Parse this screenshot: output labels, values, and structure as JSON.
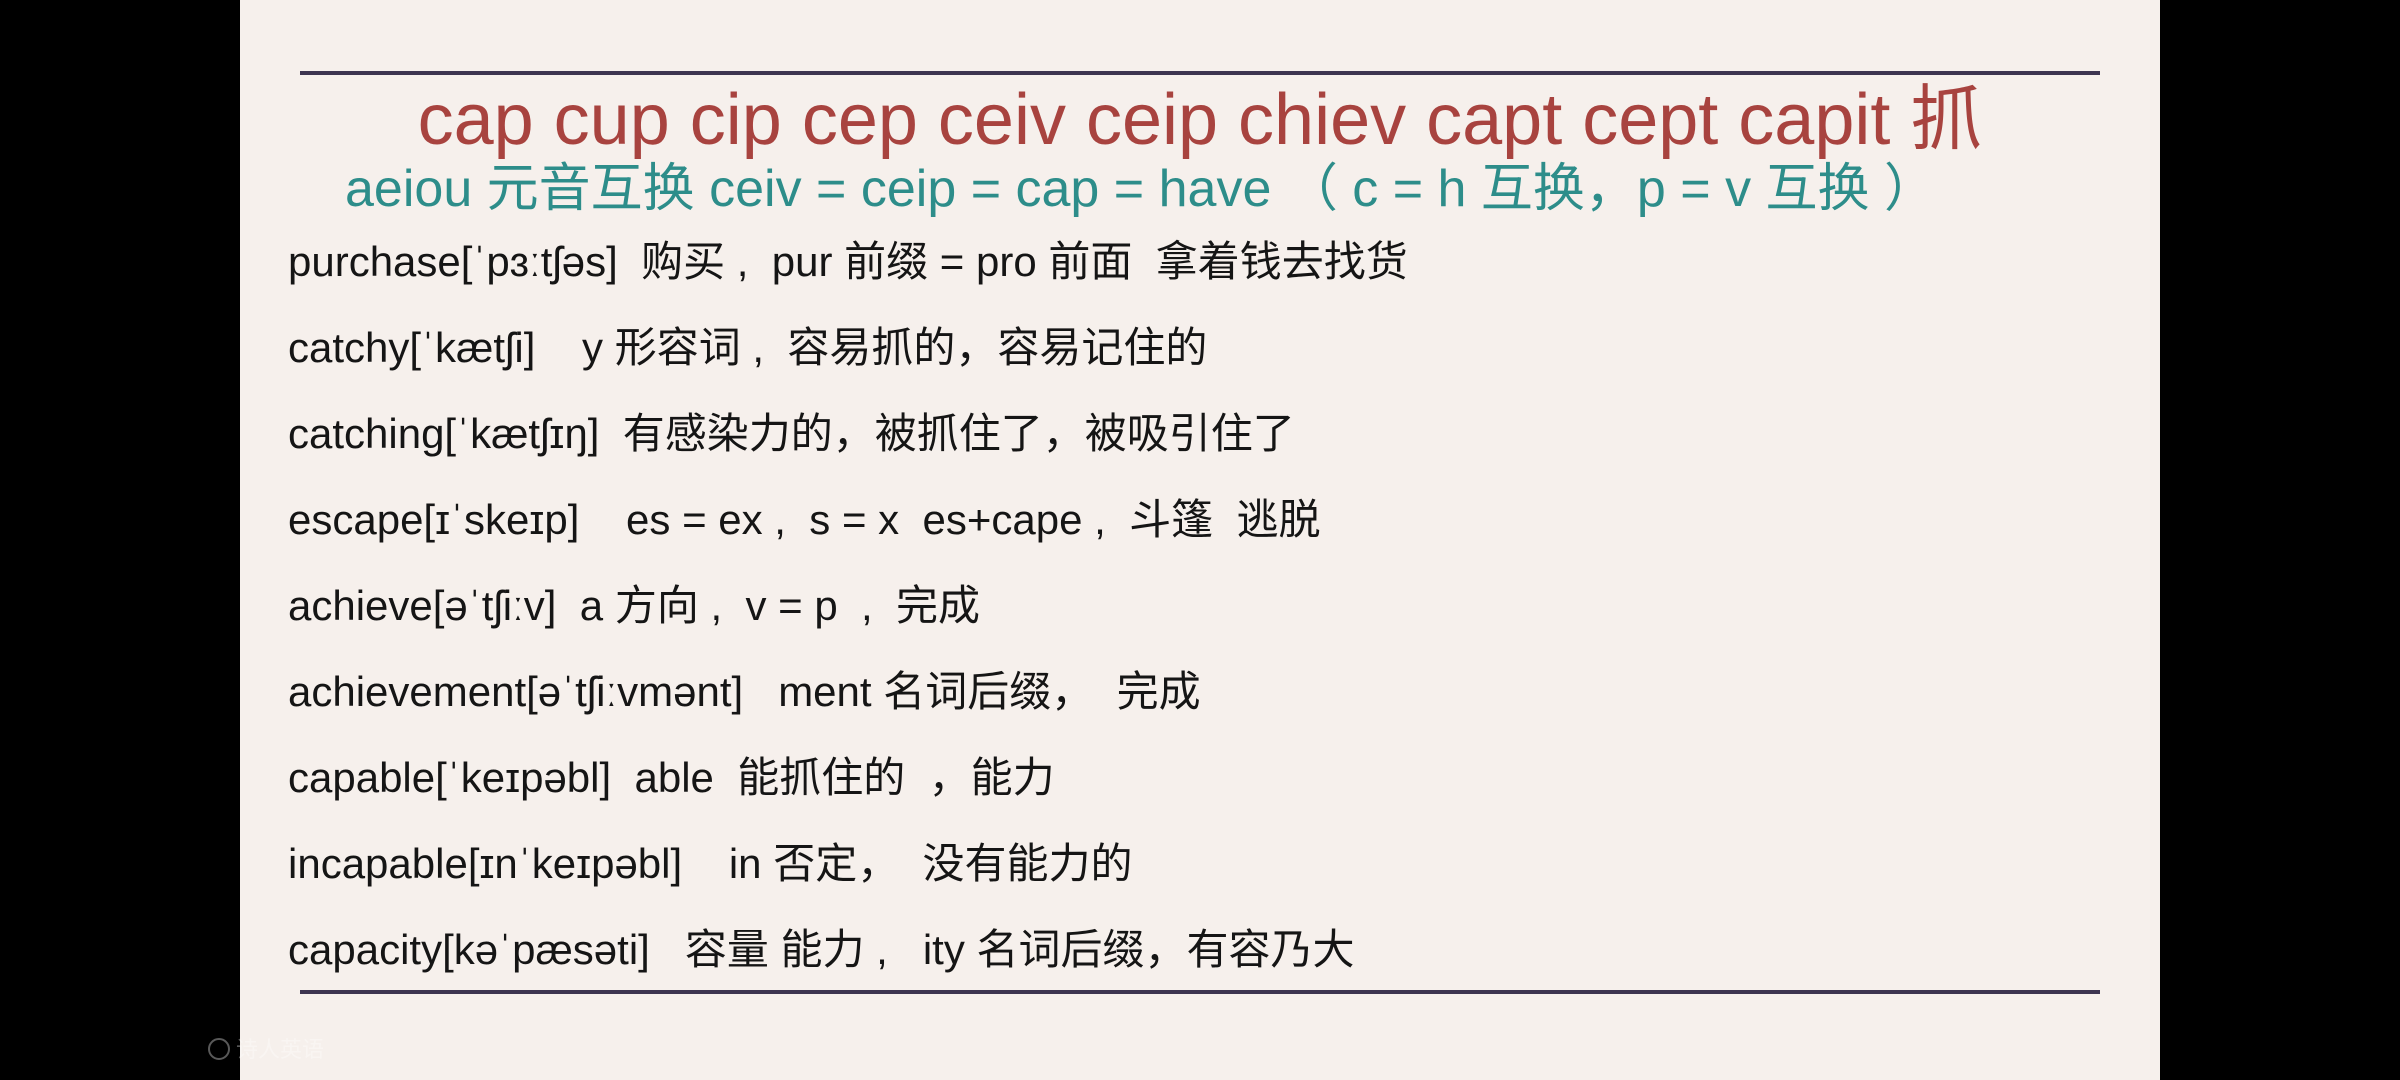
{
  "slide": {
    "title": "cap cup cip cep ceiv ceip chiev capt cept capit 抓",
    "subtitle": "aeiou 元音互换 ceiv = ceip = cap = have （ c = h 互换，p = v 互换 ）",
    "entries": [
      "purchase[ˈpɜːtʃəs]  购买 ,  pur 前缀 = pro 前面  拿着钱去找货",
      "catchy[ˈkætʃi]    y 形容词 ,  容易抓的，容易记住的",
      "catching[ˈkætʃɪŋ]  有感染力的，被抓住了，被吸引住了",
      "escape[ɪˈskeɪp]    es = ex ,  s = x  es+cape ,  斗篷  逃脱",
      "achieve[əˈtʃiːv]  a 方向 ,  v = p  ,  完成",
      "achievement[əˈtʃiːvmənt]   ment 名词后缀，  完成",
      "capable[ˈkeɪpəbl]  able  能抓住的  ，能力",
      "incapable[ɪnˈkeɪpəbl]    in 否定，  没有能力的",
      "capacity[kəˈpæsəti]   容量 能力 ,   ity 名词后缀，有容乃大"
    ]
  },
  "watermark": {
    "text": "诗人英语",
    "icon": "account-icon"
  },
  "colors": {
    "title": "#a8433f",
    "subtitle": "#2d8d8a",
    "rule": "#3d3550",
    "slide_background": "#f6f0ec",
    "page_background": "#000000"
  }
}
